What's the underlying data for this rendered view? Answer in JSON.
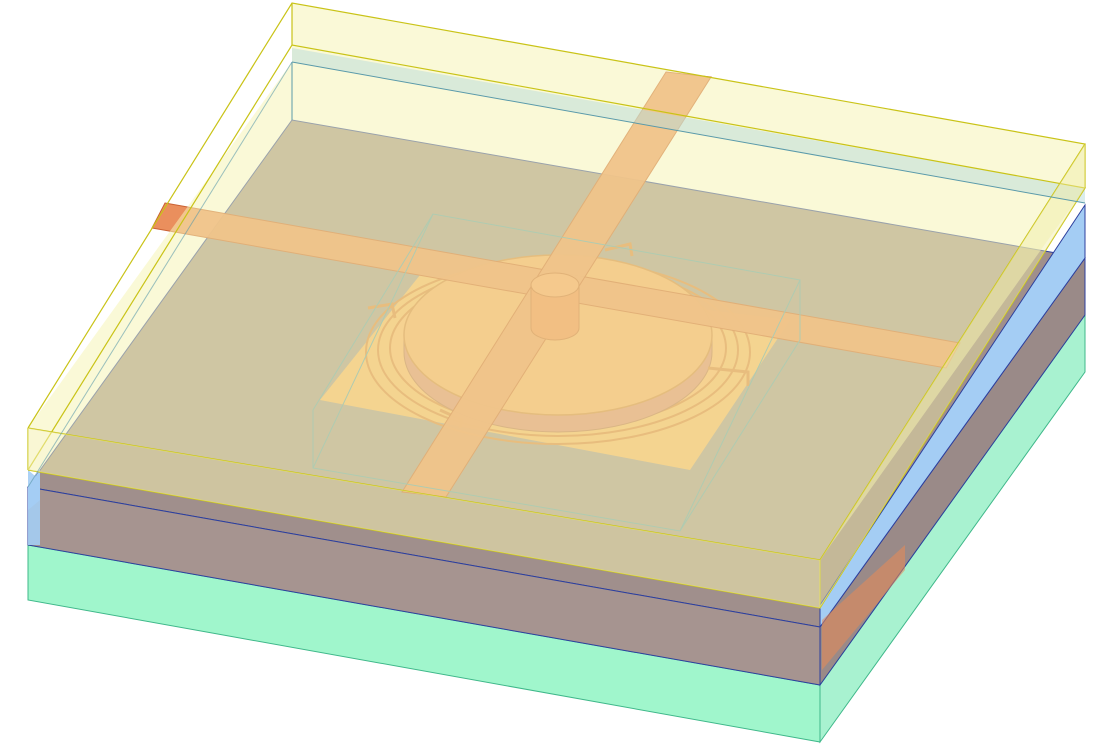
{
  "diagram": {
    "kind": "3d-layer-stack-rendering",
    "colors": {
      "background": "#ffffff",
      "bottom_substrate": "#9ff5cc",
      "bottom_substrate_edge": "#3fb88a",
      "mid_layer": "#9f8f8c",
      "mid_layer_side": "#a2ccf2",
      "mid_layer_edge": "#2c3f9e",
      "top_dielectric": "#b9ae83",
      "top_dielectric_fill": "#f4f4b8",
      "top_dielectric_edge": "#c9c317",
      "inner_box_edge": "#5a9aaa",
      "metal_strip": "#e98a55",
      "metal_strip_edge": "#c85a2a",
      "disk": "#f2a05e",
      "disk_edge": "#d07a3a",
      "disk_side": "#d9826a",
      "post": "#ee7f45",
      "inner_pad": "#f7b060"
    },
    "components": [
      {
        "name": "bottom-substrate-layer",
        "color_key": "bottom_substrate"
      },
      {
        "name": "mid-layer",
        "color_key": "mid_layer"
      },
      {
        "name": "top-dielectric-layer",
        "color_key": "top_dielectric"
      },
      {
        "name": "inner-cavity-box",
        "color_key": "inner_box_edge"
      },
      {
        "name": "horizontal-metal-strip",
        "color_key": "metal_strip"
      },
      {
        "name": "vertical-metal-strip",
        "color_key": "metal_strip"
      },
      {
        "name": "resonator-disk",
        "color_key": "disk"
      },
      {
        "name": "center-post",
        "color_key": "post"
      }
    ]
  }
}
